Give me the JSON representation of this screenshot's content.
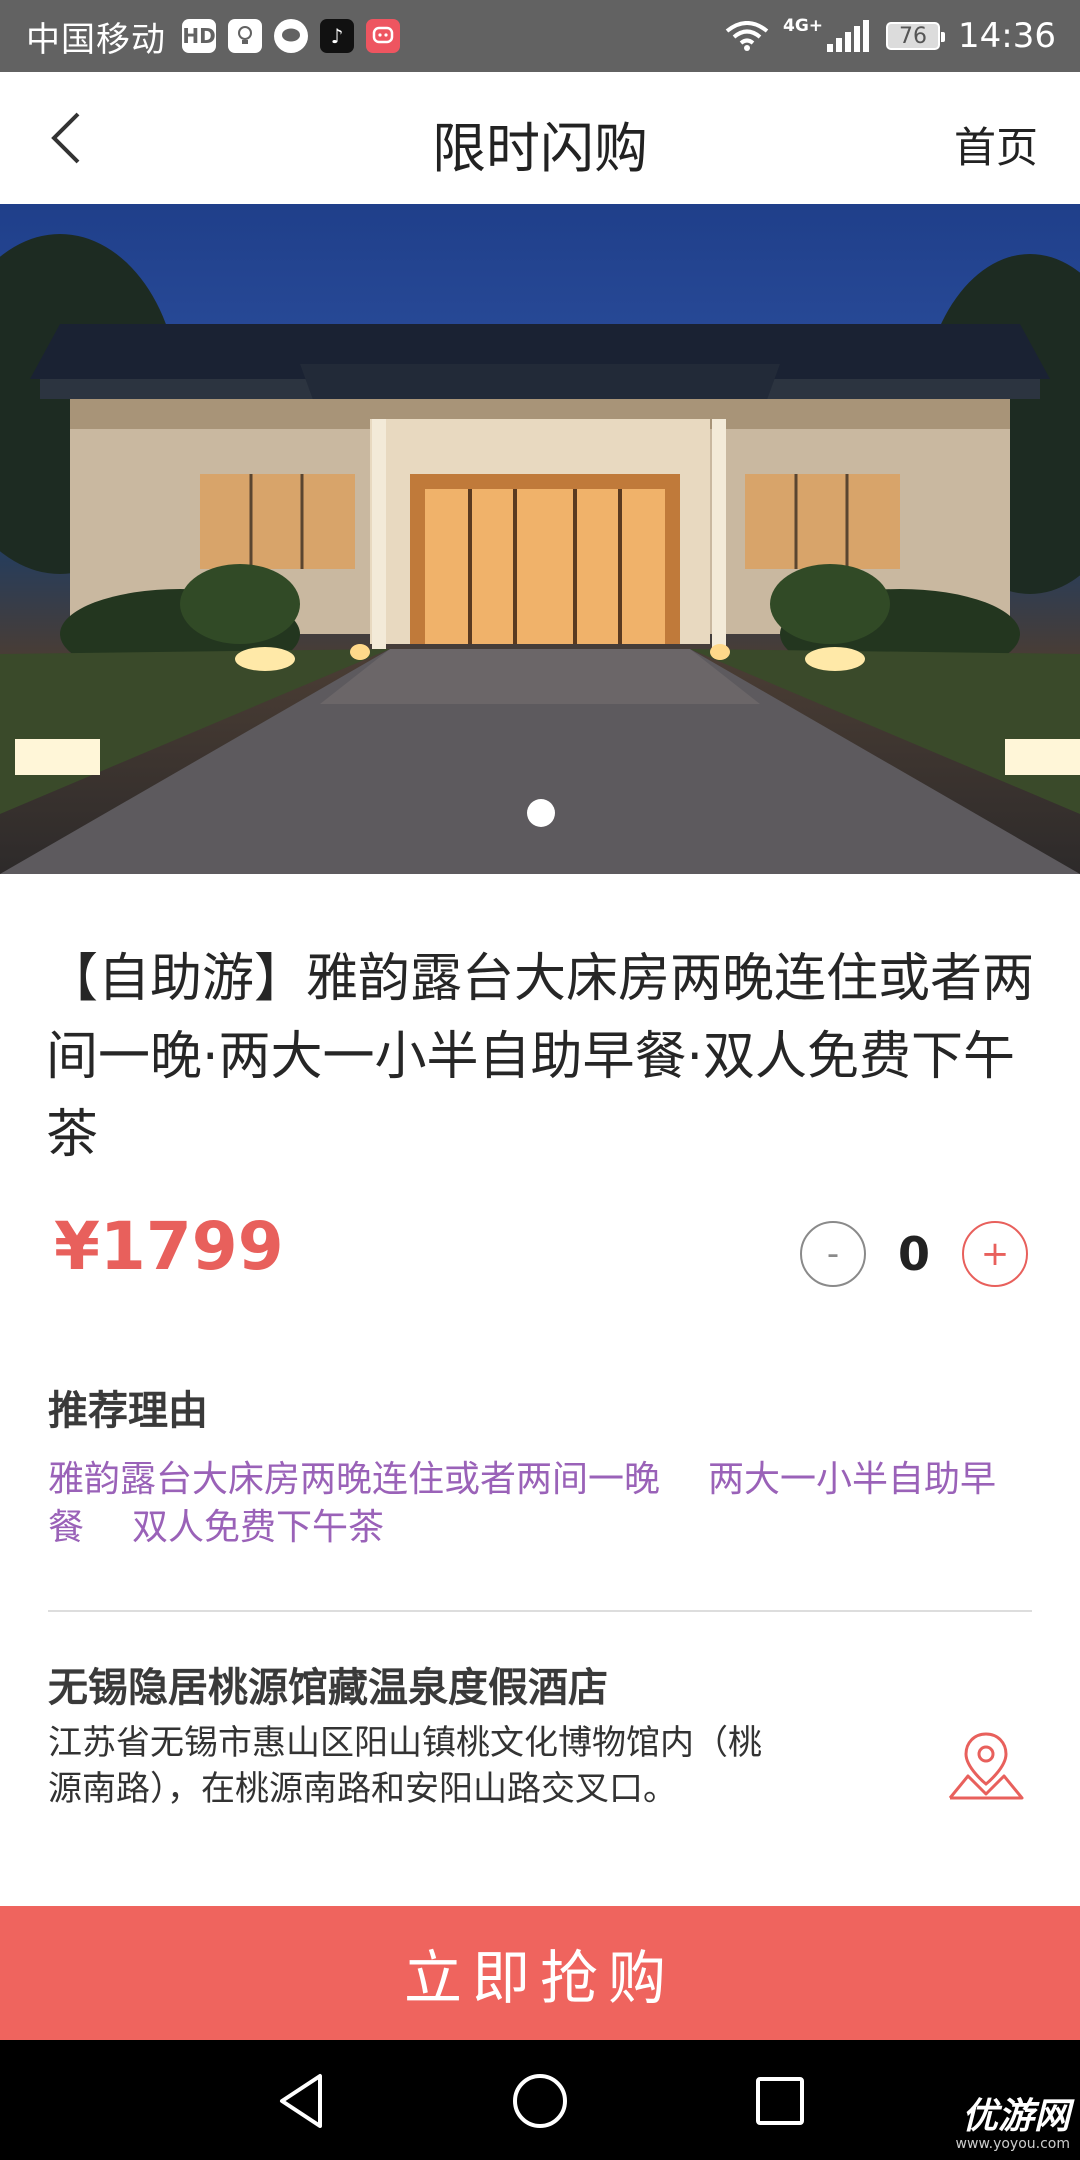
{
  "status_bar": {
    "carrier": "中国移动",
    "hd_badge": "HD",
    "network_label": "4G+",
    "battery": "76",
    "time": "14:36",
    "icons": [
      "hd-icon",
      "lightbulb-icon",
      "chat-bubble-icon",
      "tiktok-icon",
      "app-notification-icon",
      "wifi-icon",
      "signal-icon",
      "battery-icon"
    ]
  },
  "header": {
    "title": "限时闪购",
    "home_link": "首页",
    "back_icon": "chevron-left-icon"
  },
  "hero": {
    "image_description": "hotel entrance at dusk",
    "carousel_active_index": 0,
    "carousel_count": 1
  },
  "product": {
    "title": "【自助游】雅韵露台大床房两晚连住或者两间一晚·两大一小半自助早餐·双人免费下午茶",
    "price": "¥1799",
    "quantity": "0",
    "minus_label": "-",
    "plus_label": "+"
  },
  "recommend": {
    "heading": "推荐理由",
    "reasons": [
      "雅韵露台大床房两晚连住或者两间一晚",
      "两大一小半自助早餐",
      "双人免费下午茶"
    ]
  },
  "hotel": {
    "name": "无锡隐居桃源馆藏温泉度假酒店",
    "address": "江苏省无锡市惠山区阳山镇桃文化博物馆内（桃源南路），在桃源南路和安阳山路交叉口。",
    "map_icon": "map-pin-icon"
  },
  "cta": {
    "buy_label": "立即抢购"
  },
  "watermark": {
    "logo": "优游网",
    "url": "www.yoyou.com"
  },
  "colors": {
    "accent": "#ef645e",
    "price": "#e8605c",
    "reason_text": "#9a62b8",
    "status_bar": "#626262"
  }
}
